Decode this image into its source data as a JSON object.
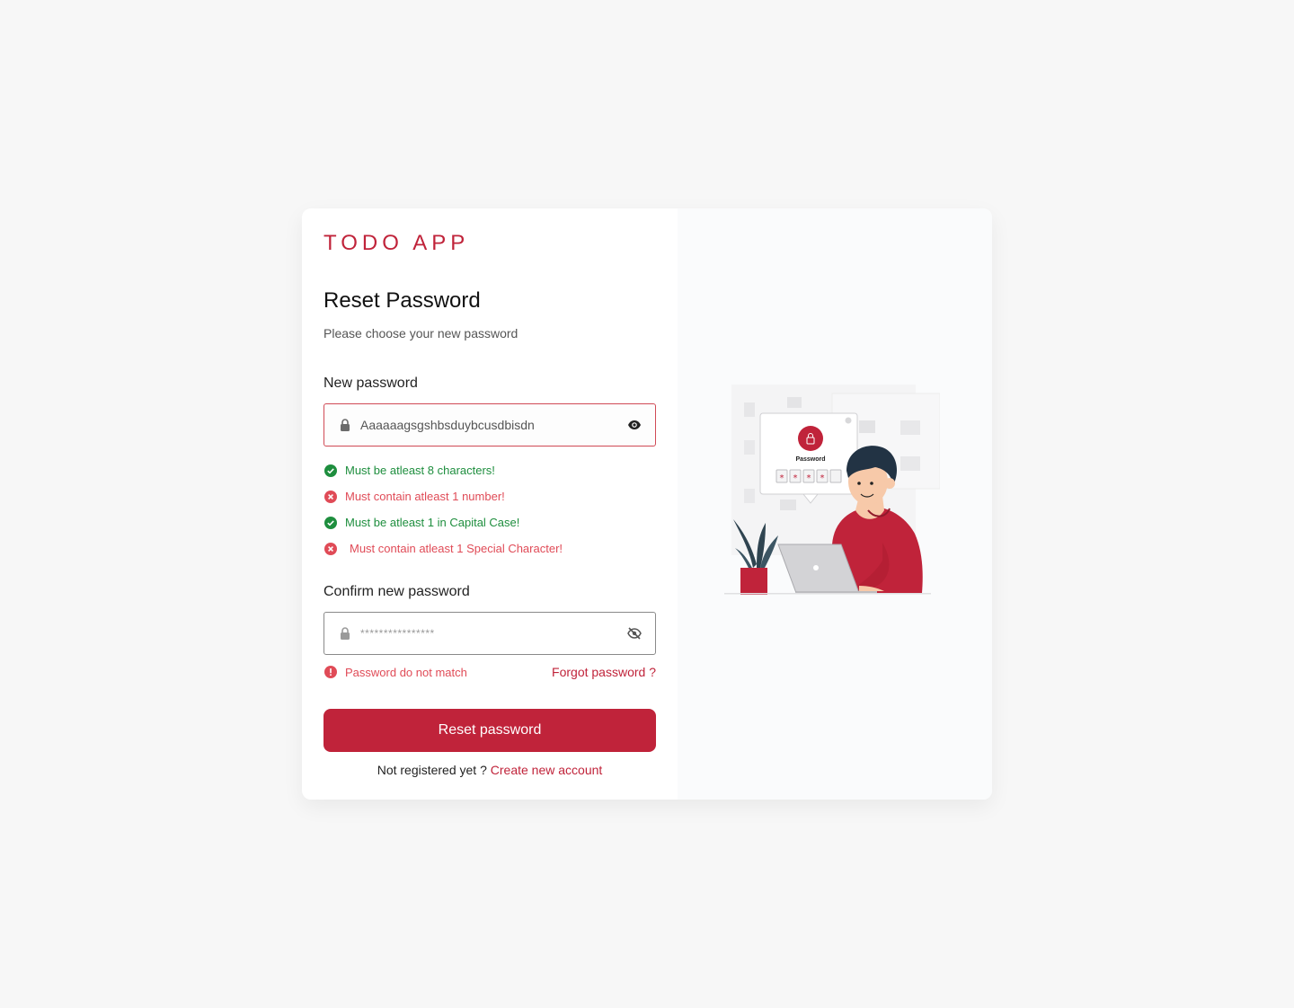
{
  "brand": "TODO APP",
  "title": "Reset Password",
  "subtitle": "Please choose your new password",
  "new_password": {
    "label": "New password",
    "value": "Aaaaaagsgshbsduybcusdbisdn"
  },
  "rules": [
    {
      "text": "Must be atleast 8 characters!",
      "status": "ok"
    },
    {
      "text": "Must contain atleast 1 number!",
      "status": "bad"
    },
    {
      "text": "Must be atleast 1 in Capital Case!",
      "status": "ok"
    },
    {
      "text": "Must contain atleast 1 Special Character!",
      "status": "bad"
    }
  ],
  "confirm_password": {
    "label": "Confirm new password",
    "value": "****************"
  },
  "mismatch_text": "Password do not match",
  "forgot_label": "Forgot password ?",
  "reset_label": "Reset password",
  "footer": {
    "prompt": "Not registered yet ?",
    "link": "Create new account"
  },
  "illustration": {
    "caption": "Password",
    "masked_chars": [
      "*",
      "*",
      "*",
      "*"
    ]
  },
  "colors": {
    "brand": "#c0233a",
    "success": "#1e8e3e",
    "error": "#e04b57"
  }
}
